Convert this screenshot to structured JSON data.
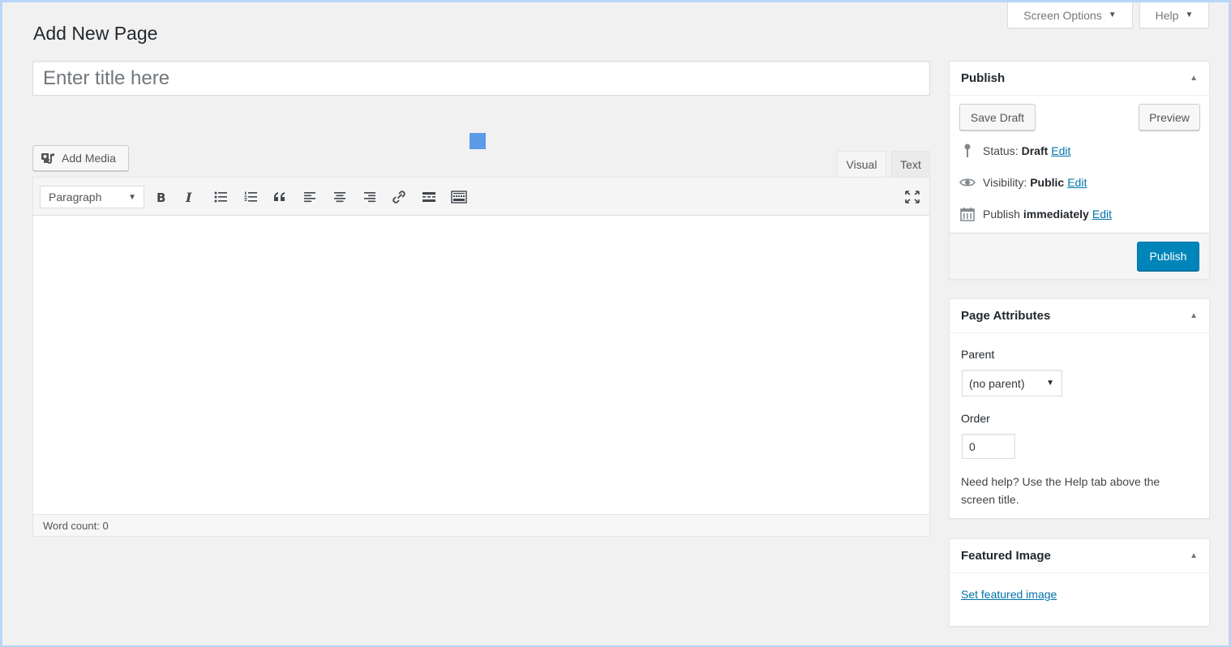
{
  "screen_meta": {
    "screen_options_label": "Screen Options",
    "help_label": "Help",
    "arrow": "▼"
  },
  "page_title": "Add New Page",
  "title_field": {
    "placeholder": "Enter title here",
    "value": ""
  },
  "editor": {
    "add_media_label": "Add Media",
    "tabs": {
      "visual": "Visual",
      "text": "Text"
    },
    "format_select": {
      "selected": "Paragraph"
    },
    "toolbar_icons": [
      "bold-icon",
      "italic-icon",
      "bulleted-list-icon",
      "numbered-list-icon",
      "blockquote-icon",
      "align-left-icon",
      "align-center-icon",
      "align-right-icon",
      "link-icon",
      "read-more-icon",
      "toolbar-toggle-icon",
      "fullscreen-icon"
    ],
    "word_count": "Word count: 0"
  },
  "publish_box": {
    "title": "Publish",
    "save_draft_label": "Save Draft",
    "preview_label": "Preview",
    "status": {
      "label": "Status:",
      "value": "Draft",
      "edit": "Edit"
    },
    "visibility": {
      "label": "Visibility:",
      "value": "Public",
      "edit": "Edit"
    },
    "schedule": {
      "label": "Publish",
      "value": "immediately",
      "edit": "Edit"
    },
    "publish_label": "Publish"
  },
  "attributes_box": {
    "title": "Page Attributes",
    "parent_label": "Parent",
    "parent_value": "(no parent)",
    "order_label": "Order",
    "order_value": "0",
    "help_text": "Need help? Use the Help tab above the screen title."
  },
  "featured_box": {
    "title": "Featured Image",
    "link_label": "Set featured image"
  },
  "colors": {
    "accent": "#0085ba",
    "link": "#0073aa",
    "background": "#f1f1f1",
    "drag_indicator": "#5b9be8"
  }
}
